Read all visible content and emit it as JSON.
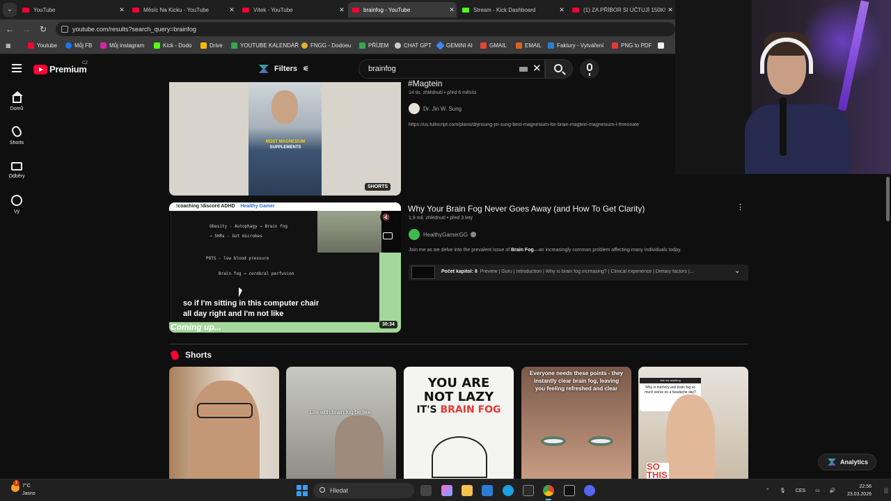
{
  "browser": {
    "tabs": [
      {
        "label": "YouTube",
        "type": "yt"
      },
      {
        "label": "Měsíc Na Kicku - YouTube",
        "type": "yt"
      },
      {
        "label": "Vítek - YouTube",
        "type": "yt"
      },
      {
        "label": "brainfog - YouTube",
        "type": "yt"
      },
      {
        "label": "Stream - Kick Dashboard",
        "type": "kick"
      },
      {
        "label": "(1) ZA PŘÍBOR SI ÚČTUJÍ 150K!",
        "type": "yt"
      }
    ],
    "active_tab_index": 3,
    "address": "youtube.com/results?search_query=brainfog",
    "bookmarks": [
      {
        "label": "Youtube",
        "color": "#ff0033"
      },
      {
        "label": "Můj FB",
        "color": "#1877f2"
      },
      {
        "label": "Můj instagram",
        "color": "#d6249f"
      },
      {
        "label": "Kick - Dodo",
        "color": "#53fc18"
      },
      {
        "label": "Drive",
        "color": "#fbbc04"
      },
      {
        "label": "YOUTUBE KALENDÁŘ",
        "color": "#34a853"
      },
      {
        "label": "FNGG - Dodoeu",
        "color": "#e0b030"
      },
      {
        "label": "PŘÍJEM",
        "color": "#34a853"
      },
      {
        "label": "CHAT GPT",
        "color": "#cccccc"
      },
      {
        "label": "GEMINI AI",
        "color": "#4285f4"
      },
      {
        "label": "GMAIL",
        "color": "#ea4335"
      },
      {
        "label": "EMAIL",
        "color": "#e06020"
      },
      {
        "label": "Faktury - Vytváření",
        "color": "#2a7fd4"
      },
      {
        "label": "PNG to PDF",
        "color": "#e53935"
      }
    ]
  },
  "header": {
    "logo_text": "Premium",
    "country_code": "CZ",
    "filters_label": "Filters",
    "search_value": "brainfog"
  },
  "rail": [
    {
      "label": "Domů",
      "icon": "home-icon"
    },
    {
      "label": "Shorts",
      "icon": "shorts-icon"
    },
    {
      "label": "Odběry",
      "icon": "subscriptions-icon"
    },
    {
      "label": "Vy",
      "icon": "you-icon"
    }
  ],
  "results": [
    {
      "title": "#Magtein",
      "meta": "14 tis. zhlédnutí • před 6 měsíci",
      "channel": "Dr. Jin W. Sung",
      "description": "https://us.fullscript.com/plans/drjinsung-jin-sung-best-magnesium-for-brain-magtein-magnesium-l-threonate",
      "thumb_caption_1": "MOST MAGNESIUM",
      "thumb_caption_2": "SUPPLEMENTS",
      "badge": "SHORTS"
    },
    {
      "title": "Why Your Brain Fog Never Goes Away (and How To Get Clarity)",
      "meta": "1,9 mil. zhlédnutí • před 3 lety",
      "channel": "HealthyGamerGG",
      "description_pre": "Join me as we delve into the prevalent issue of ",
      "description_bold": "Brain Fog",
      "description_post": "—an increasingly common problem affecting many individuals today.",
      "thumb_top_tags": "!coaching   !discord   ADHD",
      "thumb_top_brand": "Healthy Gamer",
      "subtitle_line1": "so if I'm sitting in this computer chair",
      "subtitle_line2": "all day right and I'm not like",
      "coming_up": "Coming up...",
      "duration": "30:34",
      "chapters_label": "Počet kapitol: 8",
      "chapters_text": "Preview | Guru | Introduction | Why is brain fog increasing? | Clinical experience | Dietary factors |..."
    }
  ],
  "shorts": {
    "heading": "Shorts",
    "items": [
      {
        "text": ""
      },
      {
        "text": "Life with brain fog be like."
      },
      {
        "text1": "YOU ARE",
        "text2": "NOT LAZY",
        "text3": "IT'S ",
        "text4": "BRAIN FOG"
      },
      {
        "text": "Everyone needs these points - they instantly clear brain fog, leaving you feeling refreshed and clear"
      },
      {
        "tag": "Ask me anything",
        "question": "Why is memory and brain fog so much worse on a headache day?",
        "caption": "SO THIS IS"
      }
    ]
  },
  "overlay": {
    "analytics_label": "Analytics"
  },
  "taskbar": {
    "weather_temp": "7°C",
    "weather_desc": "Jasno",
    "search_placeholder": "Hledat",
    "lang": "CES",
    "time": "22:56",
    "date": "23.03.2026"
  }
}
